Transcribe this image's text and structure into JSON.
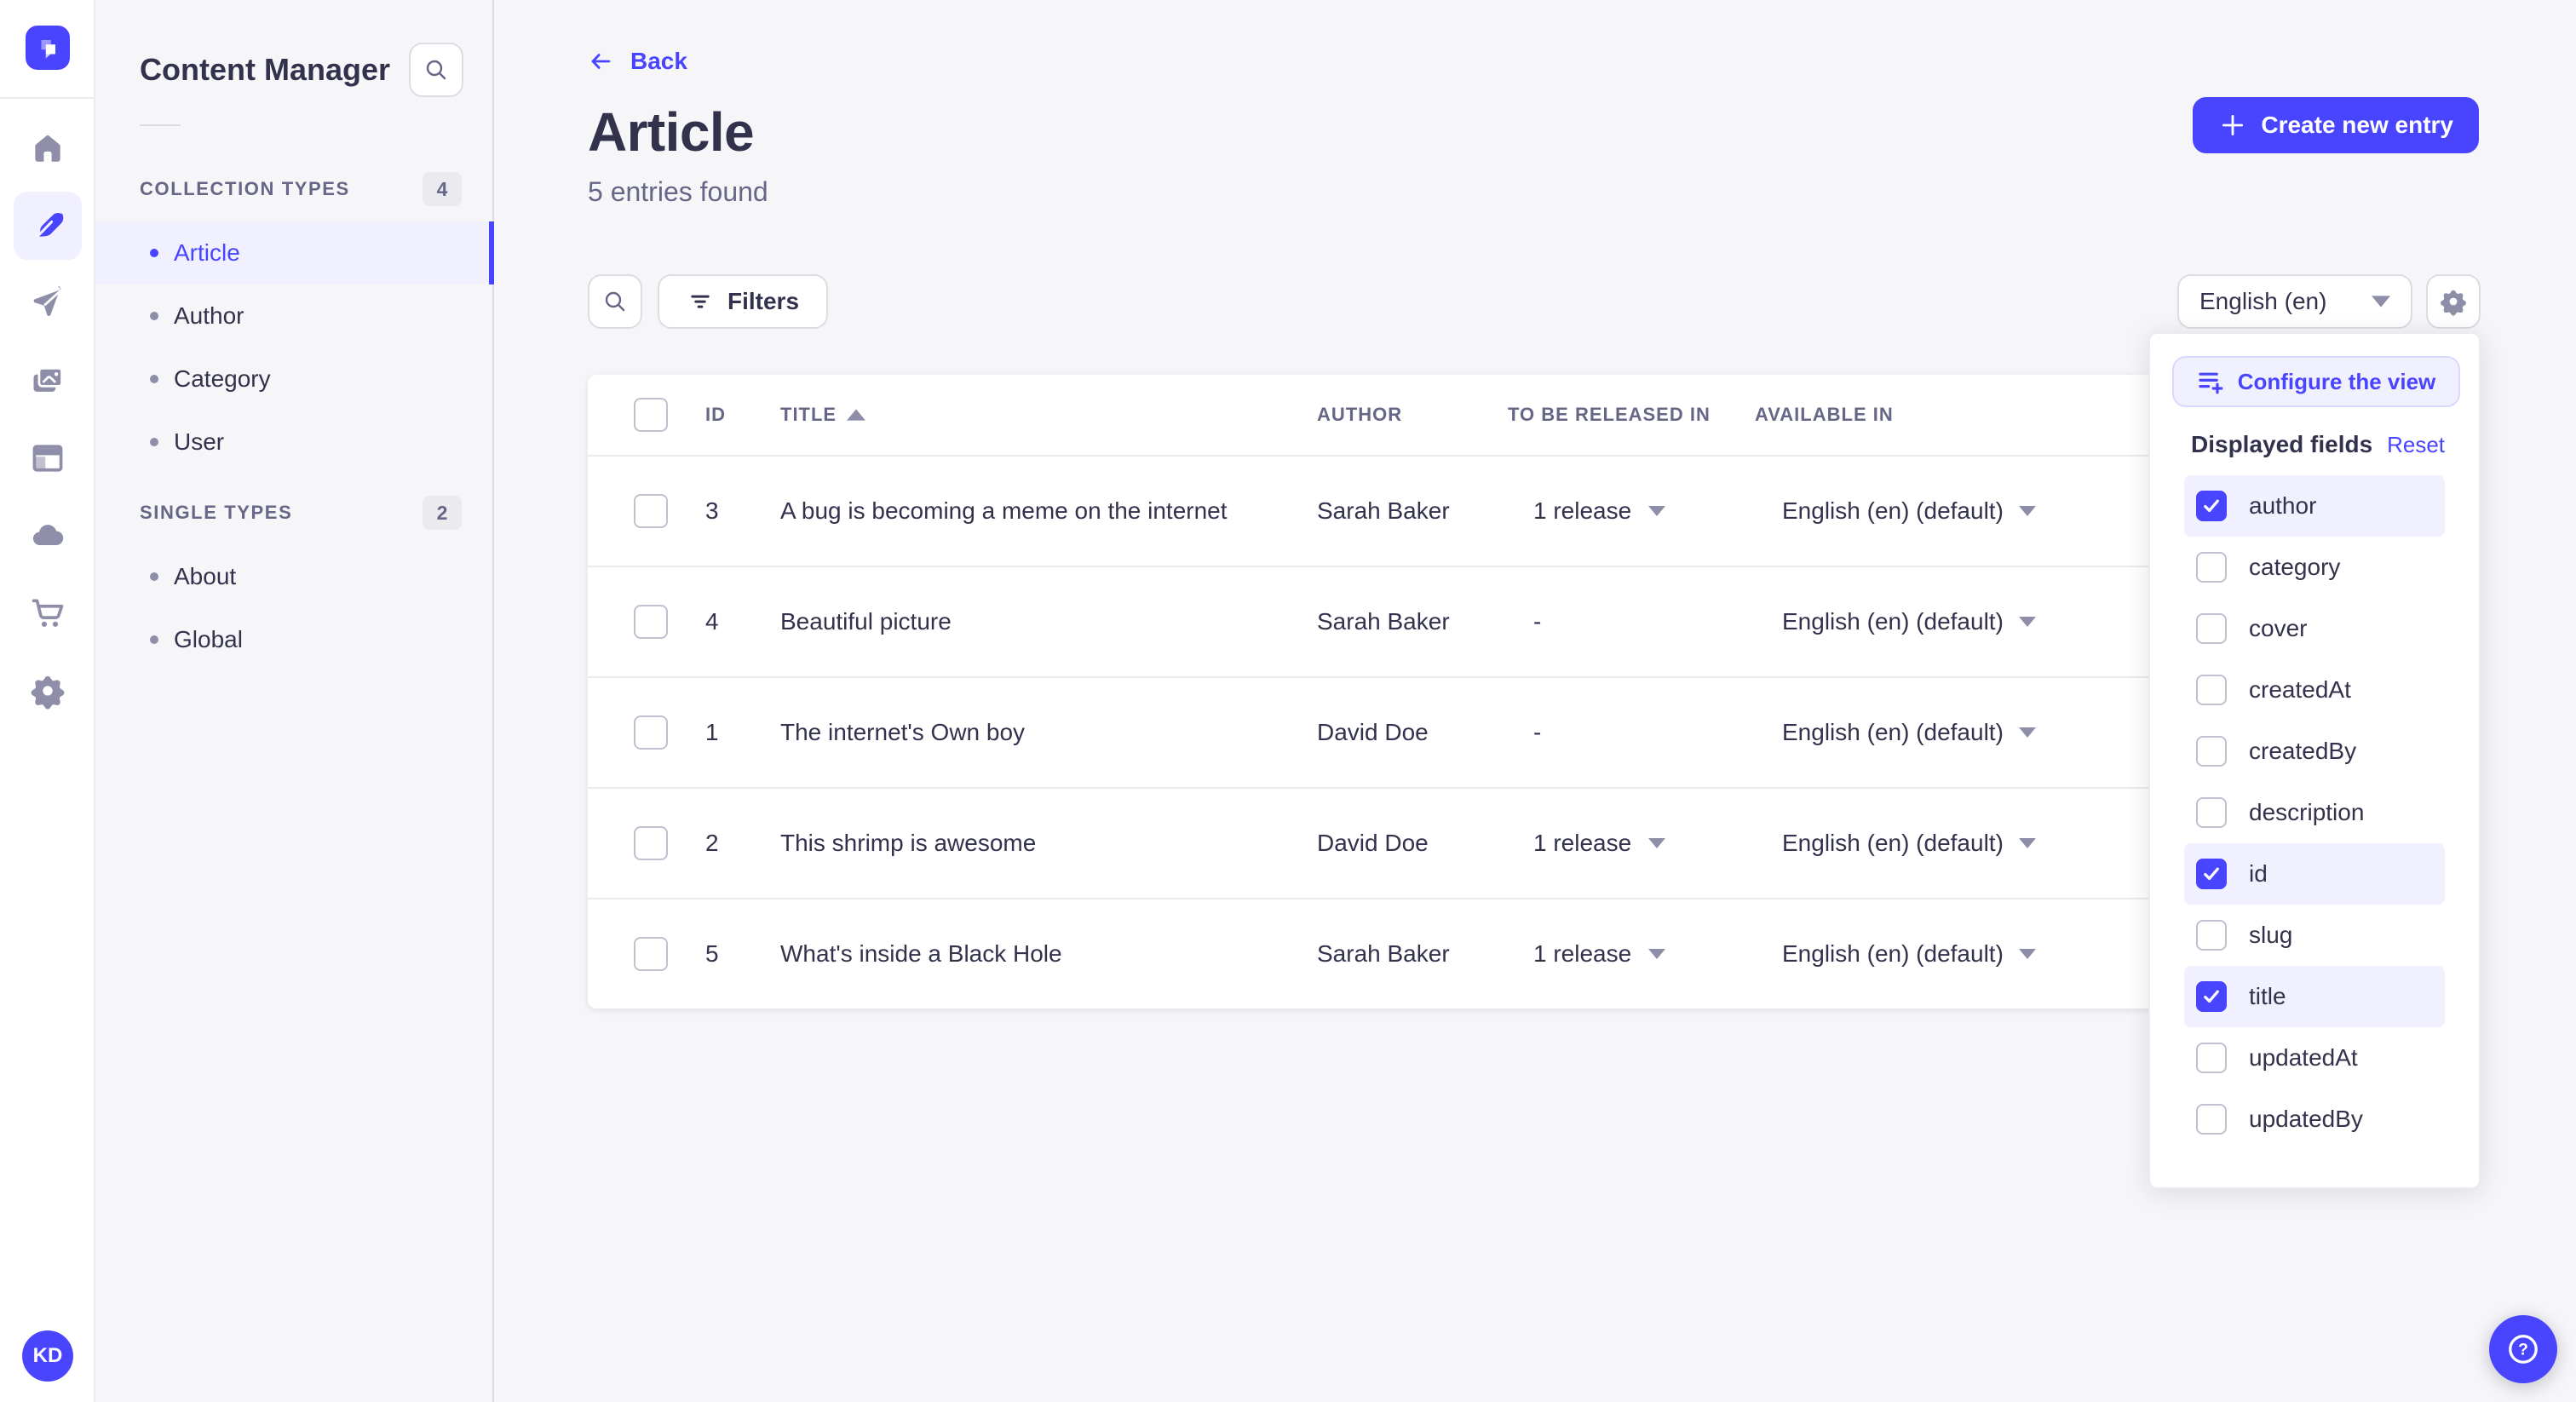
{
  "colors": {
    "primary": "#4945ff",
    "primary_bg": "#f0f0ff",
    "primary_border": "#d9d8ff",
    "page_bg": "#f6f6f9",
    "border": "#eaeaef",
    "input_border": "#dcdce4",
    "text": "#32324d",
    "text_muted": "#666687",
    "icon_muted": "#8e8ea9"
  },
  "rail": {
    "items": [
      "home",
      "content-manager",
      "releases",
      "media-library",
      "content-type-builder",
      "deploy",
      "marketplace",
      "settings"
    ],
    "active": "content-manager",
    "avatar_initials": "KD"
  },
  "sidebar": {
    "title": "Content Manager",
    "sections": [
      {
        "label": "COLLECTION TYPES",
        "count": "4",
        "items": [
          {
            "label": "Article",
            "active": true
          },
          {
            "label": "Author",
            "active": false
          },
          {
            "label": "Category",
            "active": false
          },
          {
            "label": "User",
            "active": false
          }
        ]
      },
      {
        "label": "SINGLE TYPES",
        "count": "2",
        "items": [
          {
            "label": "About",
            "active": false
          },
          {
            "label": "Global",
            "active": false
          }
        ]
      }
    ]
  },
  "header": {
    "back_label": "Back",
    "title": "Article",
    "subtitle": "5 entries found",
    "create_button_label": "Create new entry"
  },
  "toolbar": {
    "filters_label": "Filters",
    "locale_value": "English (en)"
  },
  "table": {
    "headers": [
      "ID",
      "TITLE",
      "AUTHOR",
      "TO BE RELEASED IN",
      "AVAILABLE IN"
    ],
    "sort": {
      "column": "TITLE",
      "direction": "asc"
    },
    "rows": [
      {
        "id": "3",
        "title": "A bug is becoming a meme on the internet",
        "author": "Sarah Baker",
        "release": "1 release",
        "available": "English (en) (default)"
      },
      {
        "id": "4",
        "title": "Beautiful picture",
        "author": "Sarah Baker",
        "release": "-",
        "available": "English (en) (default)"
      },
      {
        "id": "1",
        "title": "The internet's Own boy",
        "author": "David Doe",
        "release": "-",
        "available": "English (en) (default)"
      },
      {
        "id": "2",
        "title": "This shrimp is awesome",
        "author": "David Doe",
        "release": "1 release",
        "available": "English (en) (default)"
      },
      {
        "id": "5",
        "title": "What's inside a Black Hole",
        "author": "Sarah Baker",
        "release": "1 release",
        "available": "English (en) (default)"
      }
    ]
  },
  "popover": {
    "configure_label": "Configure the view",
    "heading": "Displayed fields",
    "reset_label": "Reset",
    "fields": [
      {
        "label": "author",
        "checked": true
      },
      {
        "label": "category",
        "checked": false
      },
      {
        "label": "cover",
        "checked": false
      },
      {
        "label": "createdAt",
        "checked": false
      },
      {
        "label": "createdBy",
        "checked": false
      },
      {
        "label": "description",
        "checked": false
      },
      {
        "label": "id",
        "checked": true
      },
      {
        "label": "slug",
        "checked": false
      },
      {
        "label": "title",
        "checked": true
      },
      {
        "label": "updatedAt",
        "checked": false
      },
      {
        "label": "updatedBy",
        "checked": false
      }
    ]
  }
}
